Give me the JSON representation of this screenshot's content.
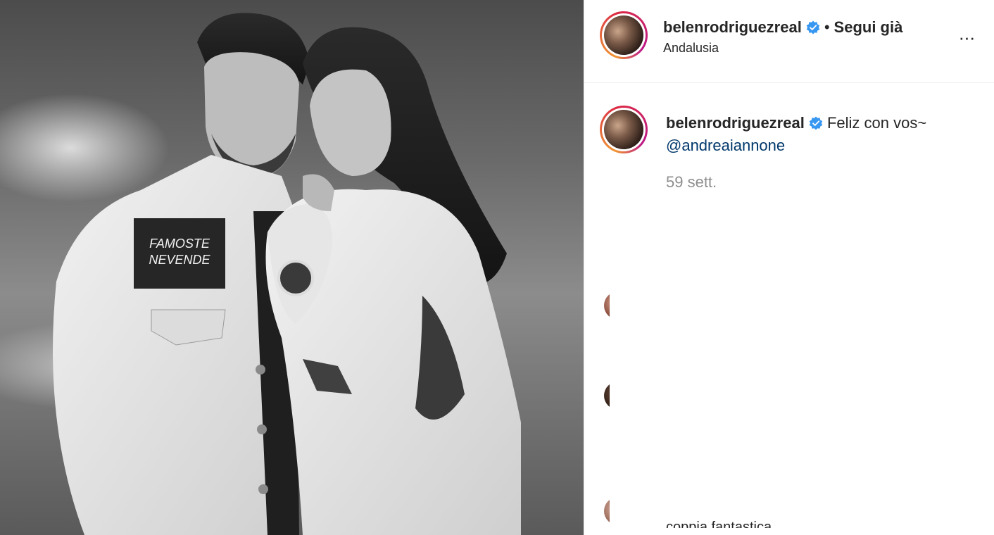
{
  "post": {
    "username": "belenrodriguezreal",
    "follow_status": "Segui già",
    "location": "Andalusia",
    "caption": "Feliz con vos~",
    "mention": "@andreaiannone",
    "timestamp": "59 sett.",
    "more_icon": "···"
  },
  "photo_patches": {
    "left_patch_text": "FAMOSTE NEVENDE"
  },
  "comments": {
    "partial_text": "coppia fantastica"
  },
  "colors": {
    "verified": "#3897f0",
    "mention": "#00376b",
    "muted": "#8e8e8e"
  }
}
